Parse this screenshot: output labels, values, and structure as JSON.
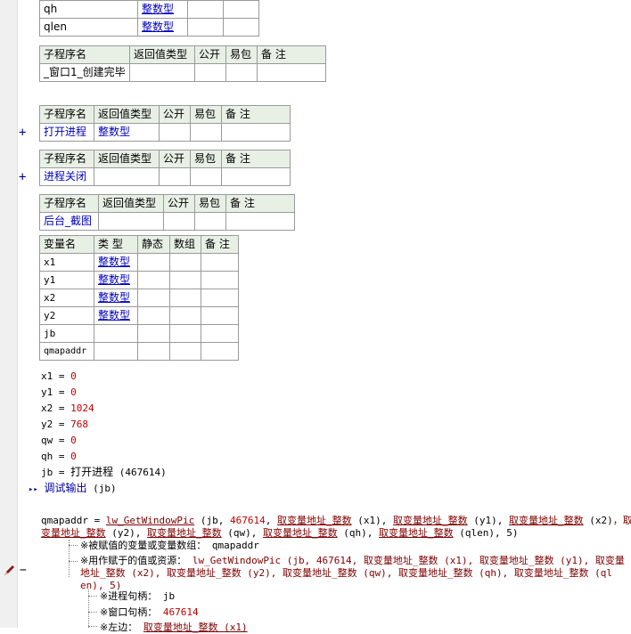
{
  "top_table": {
    "rows": [
      {
        "name": "qh",
        "type": "整数型"
      },
      {
        "name": "qlen",
        "type": "整数型"
      }
    ]
  },
  "sub_headers": {
    "name": "子程序名",
    "ret": "返回值类型",
    "pub": "公开",
    "easy": "易包",
    "note": "备 注"
  },
  "subs": [
    {
      "name": "_窗口1_创建完毕",
      "ret": "",
      "collapsed": false
    },
    {
      "name": "打开进程",
      "ret": "整数型",
      "collapsed": true,
      "expander": "+"
    },
    {
      "name": "进程关闭",
      "ret": "",
      "collapsed": true,
      "expander": "+"
    },
    {
      "name": "后台_截图",
      "ret": "",
      "collapsed": false
    }
  ],
  "var_headers": {
    "name": "变量名",
    "type": "类 型",
    "static": "静态",
    "array": "数组",
    "note": "备 注"
  },
  "vars": [
    {
      "name": "x1",
      "type": "整数型"
    },
    {
      "name": "y1",
      "type": "整数型"
    },
    {
      "name": "x2",
      "type": "整数型"
    },
    {
      "name": "y2",
      "type": "整数型"
    },
    {
      "name": "jb",
      "type": ""
    },
    {
      "name": "qmapaddr",
      "type": ""
    }
  ],
  "assigns": [
    {
      "lhs": "x1",
      "op": " = ",
      "rhs": "0"
    },
    {
      "lhs": "y1",
      "op": " = ",
      "rhs": "0"
    },
    {
      "lhs": "x2",
      "op": " = ",
      "rhs": "1024"
    },
    {
      "lhs": "y2",
      "op": " = ",
      "rhs": "768"
    },
    {
      "lhs": "qw",
      "op": " = ",
      "rhs": "0"
    },
    {
      "lhs": "qh",
      "op": " = ",
      "rhs": "0"
    }
  ],
  "jb_line": {
    "lhs": "jb = ",
    "fn": "打开进程",
    "arg": " (467614)"
  },
  "debug_line": {
    "marker": "▸▸",
    "fn": "调试输出",
    "arg": " (jb)"
  },
  "code": {
    "l1a": "qmapaddr = ",
    "fn": "lw_GetWindowPic",
    "l1b": " (jb, ",
    "n1": "467614",
    "sep": ", ",
    "addr": "取变量地址_整数",
    "x1": " (x1)",
    "y1": " (y1)",
    "x2": " (x2)",
    "end1": "，取",
    "l2b": "变量地址_整数",
    "y2": " (y2)",
    "qw": " (qw)",
    "qh": " (qh)",
    "qlen": " (qlen)",
    "five": ", 5)",
    "c1_label": "※被赋值的变量或变量数组：",
    "c1_val": "qmapaddr",
    "c2_label": "※用作赋于的值或资源：",
    "c2_a": "lw_GetWindowPic (jb, 467614, 取变量地址_整数 (x1), 取变量地址_整数 (y1), 取变量",
    "c2_b": "地址_整数 (x2), 取变量地址_整数 (y2), 取变量地址_整数 (qw), 取变量地址_整数 (qh), 取变量地址_整数 (ql",
    "c2_c": "en), 5)",
    "p1_label": "※进程句柄：",
    "p1_val": "jb",
    "p2_label": "※窗口句柄：",
    "p2_val": "467614",
    "p3_label": "※左边：",
    "p3_val": "取变量地址_整数 (x1)"
  },
  "edit_marker": {
    "icon": "pencil-icon",
    "minus": "−"
  }
}
